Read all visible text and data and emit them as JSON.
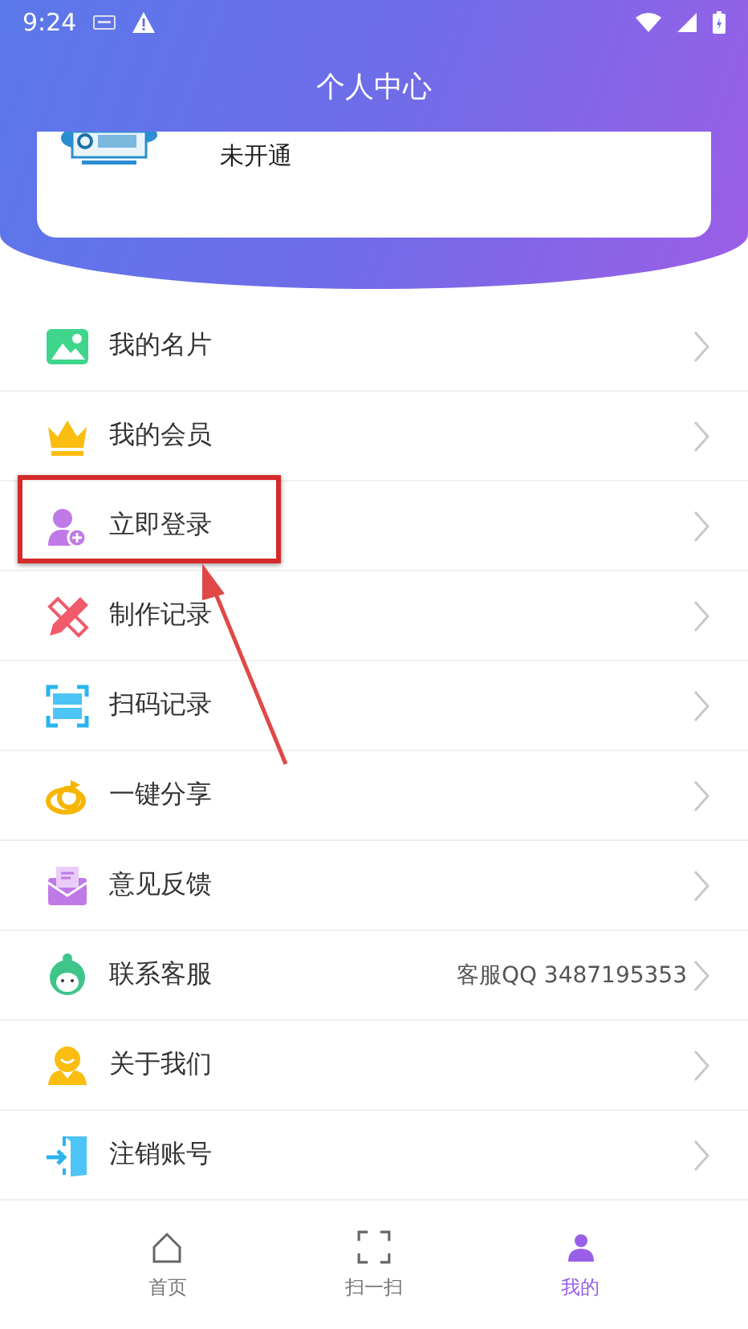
{
  "status_bar": {
    "time": "9:24"
  },
  "header": {
    "title": "个人中心"
  },
  "card": {
    "status": "未开通"
  },
  "menu": [
    {
      "label": "我的名片",
      "highlighted": false
    },
    {
      "label": "我的会员",
      "highlighted": false
    },
    {
      "label": "立即登录",
      "highlighted": true
    },
    {
      "label": "制作记录",
      "highlighted": false
    },
    {
      "label": "扫码记录",
      "highlighted": false
    },
    {
      "label": "一键分享",
      "highlighted": false
    },
    {
      "label": "意见反馈",
      "highlighted": false
    },
    {
      "label": "联系客服",
      "detail": "客服QQ 3487195353",
      "highlighted": false
    },
    {
      "label": "关于我们",
      "highlighted": false
    },
    {
      "label": "注销账号",
      "highlighted": false
    }
  ],
  "bottom_nav": [
    {
      "label": "首页",
      "selected": false
    },
    {
      "label": "扫一扫",
      "selected": false
    },
    {
      "label": "我的",
      "selected": true
    }
  ]
}
